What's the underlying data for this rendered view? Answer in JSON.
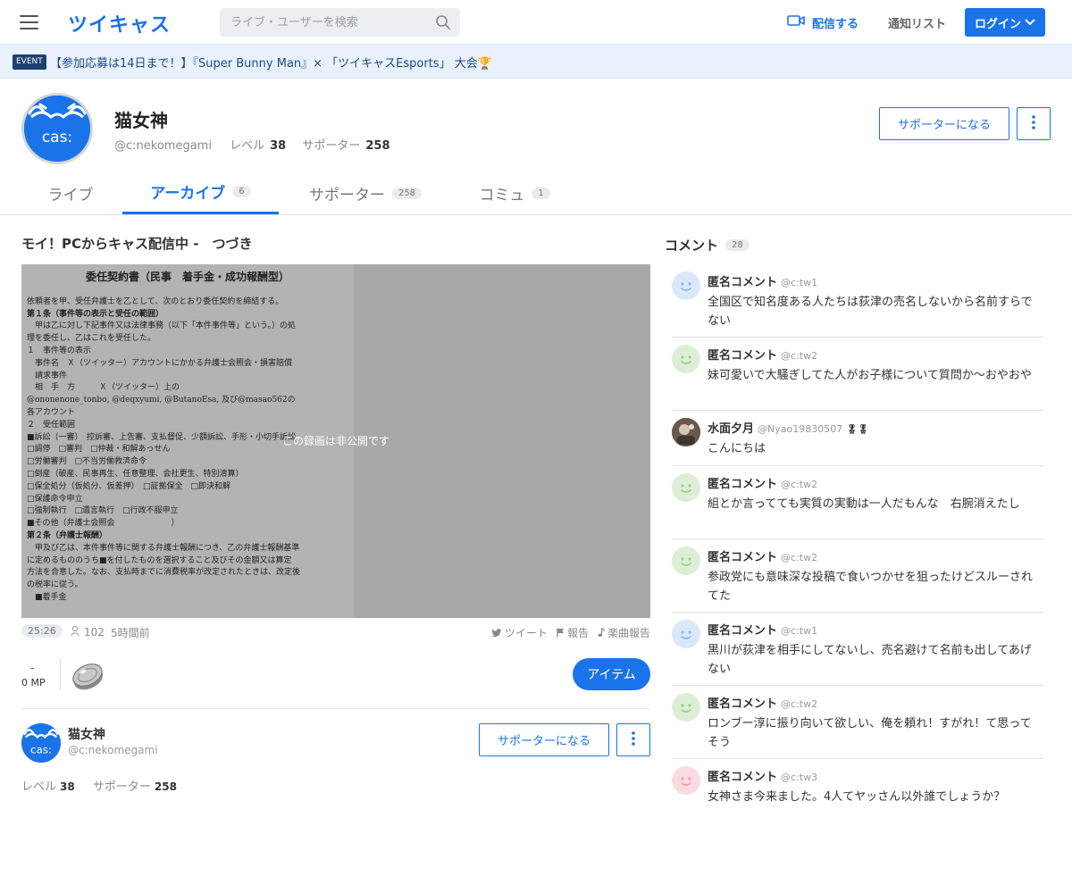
{
  "header": {
    "logo": "ツイキャス",
    "search_placeholder": "ライブ・ユーザーを検索",
    "broadcast_label": "配信する",
    "notify_label": "通知リスト",
    "login_label": "ログイン"
  },
  "event": {
    "badge": "EVENT",
    "text": "【参加応募は14日まで！】『Super Bunny Man』× 「ツイキャスEsports」 大会🏆"
  },
  "profile": {
    "name": "猫女神",
    "id": "@c:nekomegami",
    "level_label": "レベル",
    "level": "38",
    "supporter_label": "サポーター",
    "supporters": "258",
    "avatar_text": "cas:",
    "support_button": "サポーターになる"
  },
  "tabs": [
    {
      "label": "ライブ",
      "count": ""
    },
    {
      "label": "アーカイブ",
      "count": "6"
    },
    {
      "label": "サポーター",
      "count": "258"
    },
    {
      "label": "コミュ",
      "count": "1"
    }
  ],
  "movie": {
    "title": "モイ！PCからキャス配信中 -　つづき",
    "private_notice": "この録画は非公開です",
    "duration": "25:26",
    "views": "102",
    "ago": "5時間前",
    "tweet_label": "ツイート",
    "report_label": "報告",
    "music_report_label": "楽曲報告",
    "mp_dash": "-",
    "mp_value": "0 MP",
    "item_button": "アイテム"
  },
  "document": {
    "heading": "委任契約書（民事　着手金・成功報酬型）",
    "lines": [
      "依頼者を甲、受任弁護士を乙として、次のとおり委任契約を締結する。",
      "第１条（事件等の表示と受任の範囲）",
      "　甲は乙に対し下記事件又は法律事務（以下「本件事件等」という。）の処",
      "理を委任し、乙はこれを受任した。",
      "１　事件等の表示",
      "　事件名　Ｘ（ツイッター）アカウントにかかる弁護士会照会・損害賠償",
      "　請求事件",
      "　相　手　方　　　Ｘ（ツイッター）上の",
      "@ononenone_tonbo, @deqxyumi, @ButanoEsa, 及び@masao562の",
      "各アカウント",
      "２　受任範囲",
      "■訴訟（一審）　控訴審、上告審、支払督促、少額訴訟、手形・小切手訴訟",
      "□調停　□審判　□仲裁・和解あっせん",
      "□労働審判　□不当労働救済命令",
      "□倒産（破産、民事再生、任意整理、会社更生、特別清算）",
      "□保全処分（仮処分、仮差押）　□証拠保全　□即決和解",
      "□保護命令申立",
      "□強制執行　□遺言執行　□行政不服申立",
      "■その他（弁護士会照会　　　　　　　）",
      "第２条（弁護士報酬）",
      "　甲及び乙は、本件事件等に関する弁護士報酬につき、乙の弁護士報酬基準",
      "に定めるもののうち■を付したものを選択すること及びその金額又は算定",
      "方法を合意した。なお、支払時までに消費税率が改定されたときは、改定後",
      "の税率に従う。",
      "　■着手金"
    ]
  },
  "comments": {
    "title": "コメント",
    "count": "28",
    "items": [
      {
        "name": "匿名コメント",
        "id": "@c:tw1",
        "text": "全国区で知名度ある人たちは荻津の売名しないから名前すらでない",
        "avatar": "blue",
        "badge": ""
      },
      {
        "name": "匿名コメント",
        "id": "@c:tw2",
        "text": "妹可愛いで大騒ぎしてた人がお子様について質問か〜おやおや",
        "avatar": "green",
        "badge": ""
      },
      {
        "name": "水面夕月",
        "id": "@Nyao19830507",
        "text": "こんにちは",
        "avatar": "photo",
        "badge": "🎖🎖"
      },
      {
        "name": "匿名コメント",
        "id": "@c:tw2",
        "text": "組とか言ってても実質の実動は一人だもんな　右腕消えたし",
        "avatar": "green",
        "badge": ""
      },
      {
        "name": "匿名コメント",
        "id": "@c:tw2",
        "text": "参政党にも意味深な投稿で食いつかせを狙ったけどスルーされてた",
        "avatar": "green",
        "badge": ""
      },
      {
        "name": "匿名コメント",
        "id": "@c:tw1",
        "text": "黒川が荻津を相手にしてないし、売名避けて名前も出してあげない",
        "avatar": "blue",
        "badge": ""
      },
      {
        "name": "匿名コメント",
        "id": "@c:tw2",
        "text": "ロンブー淳に振り向いて欲しい、俺を頼れ！すがれ！て思ってそう",
        "avatar": "green",
        "badge": ""
      },
      {
        "name": "匿名コメント",
        "id": "@c:tw3",
        "text": "女神さま今来ました。4人てヤッさん以外誰でしょうか？",
        "avatar": "pink",
        "badge": ""
      }
    ]
  },
  "colors": {
    "accent": "#1a73e8",
    "event_bg": "#e8f1fc",
    "avatar_blue": "#dbe8fb",
    "avatar_green": "#dcefd6",
    "avatar_pink": "#fadbe0"
  },
  "icons": {
    "menu": "hamburger-icon",
    "search": "search-icon",
    "broadcast": "video-camera-icon",
    "login_chevron": "chevron-down-icon",
    "more": "more-vertical-icon",
    "views": "person-icon",
    "tweet": "twitter-bird-icon",
    "report": "flag-icon",
    "music": "music-note-icon",
    "coin": "coin-icon",
    "face": "smiley-face-icon"
  }
}
